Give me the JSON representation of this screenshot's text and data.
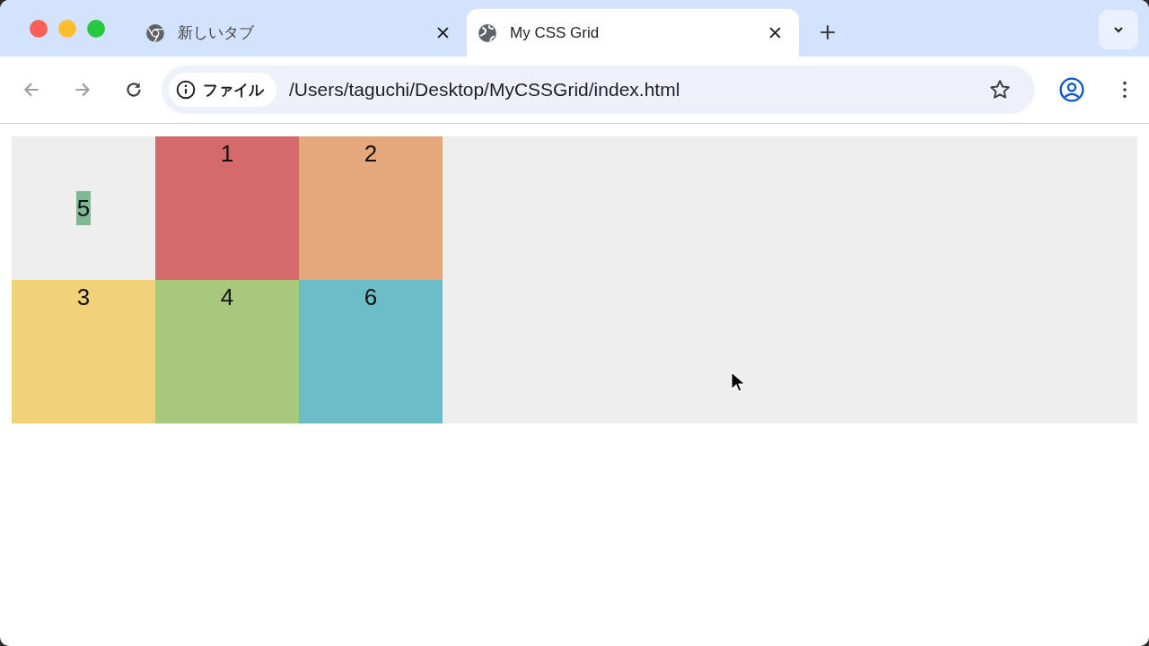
{
  "tabs": [
    {
      "title": "新しいタブ",
      "kind": "chrome",
      "selected": false
    },
    {
      "title": "My CSS Grid",
      "kind": "globe",
      "selected": true
    }
  ],
  "address_bar": {
    "chip": "ファイル",
    "url": "/Users/taguchi/Desktop/MyCSSGrid/index.html"
  },
  "grid": {
    "items": [
      {
        "label": "5",
        "kind": "centered",
        "color": "#7fb894"
      },
      {
        "label": "1",
        "kind": "fill",
        "color": "#d46a6a"
      },
      {
        "label": "2",
        "kind": "fill",
        "color": "#e4a87b"
      },
      {
        "label": "3",
        "kind": "fill",
        "color": "#f1d17a"
      },
      {
        "label": "4",
        "kind": "fill",
        "color": "#a8c87e"
      },
      {
        "label": "6",
        "kind": "fill",
        "color": "#6cbdc8"
      }
    ]
  }
}
